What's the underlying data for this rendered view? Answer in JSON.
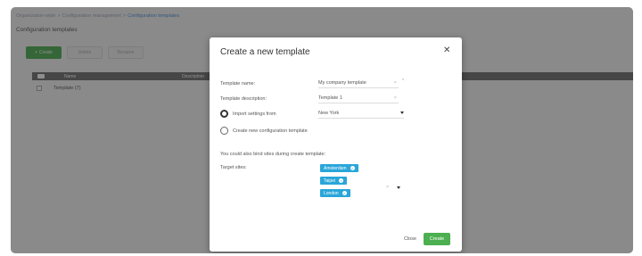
{
  "breadcrumb": {
    "items": [
      "Organization-wide",
      "Configuration management",
      "Configuration templates"
    ],
    "separator": ">"
  },
  "page": {
    "title": "Configuration templates"
  },
  "toolbar": {
    "create_label": "Create",
    "create_icon": "plus-icon",
    "delete_label": "Delete",
    "rename_label": "Rename"
  },
  "table": {
    "headers": {
      "name": "Name",
      "description": "Description"
    },
    "rows": [
      {
        "name": "Template (7)"
      }
    ]
  },
  "modal": {
    "title": "Create a new template",
    "close_glyph": "✕",
    "template_name_label": "Template name:",
    "template_name_value": "My company template",
    "template_description_label": "Template description:",
    "template_description_value": "Template 1",
    "clear_glyph": "×",
    "required_marker": "*",
    "import_label": "Import settings from",
    "import_value": "New York",
    "create_new_label": "Create new configuration template",
    "bind_info": "You could also bind sites during create template:",
    "target_sites_label": "Target sites:",
    "target_sites": [
      "Amsterdam",
      "Taipei",
      "London"
    ],
    "tag_remove_glyph": "×",
    "close_button": "Close",
    "create_button": "Create"
  },
  "colors": {
    "primary_green": "#4caf50",
    "tag_blue": "#2aa6d9",
    "header_gray": "#6f6f6f"
  }
}
